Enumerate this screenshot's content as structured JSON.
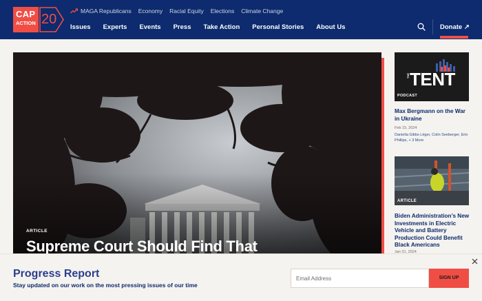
{
  "logo": {
    "line1": "CAP",
    "line2": "ACTION",
    "number": "20"
  },
  "topics": [
    "MAGA Republicans",
    "Economy",
    "Racial Equity",
    "Elections",
    "Climate Change"
  ],
  "nav": [
    "Issues",
    "Experts",
    "Events",
    "Press",
    "Take Action",
    "Personal Stories",
    "About Us"
  ],
  "donate": "Donate ↗",
  "hero": {
    "tag": "ARTICLE",
    "title": "Supreme Court Should Find That"
  },
  "sidebar": {
    "card1": {
      "podcast_the": "THE",
      "podcast_name": "TENT",
      "label": "PODCAST",
      "title": "Max Bergmann on the War in Ukraine",
      "date": "Feb 15, 2024",
      "authors": "Daniella Gibbs Léger, Colin Seeberger, Erin Phillips, + 3 More"
    },
    "card2": {
      "label": "ARTICLE",
      "title": "Biden Administration’s New Investments in Electric Vehicle and Battery Production Could Benefit Black Americans",
      "date": "Jan 31, 2024"
    }
  },
  "newsletter": {
    "title": "Progress Report",
    "subtitle": "Stay updated on our work on the most pressing issues of our time",
    "email_placeholder": "Email Address",
    "signup": "SIGN UP"
  },
  "colors": {
    "navy": "#0d2b6e",
    "accent": "#f04e45",
    "background": "#f5f3ef"
  }
}
